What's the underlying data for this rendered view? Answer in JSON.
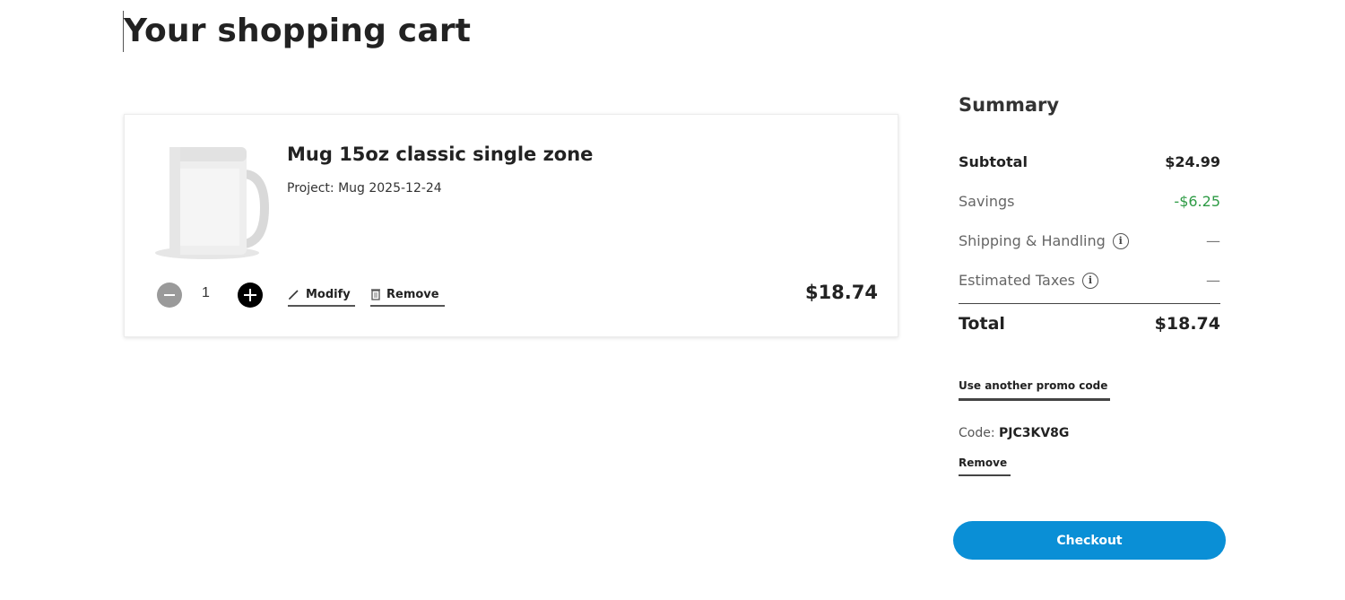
{
  "page": {
    "title": "Your shopping cart"
  },
  "cart": {
    "items": [
      {
        "name": "Mug 15oz classic single zone",
        "project_label": "Project: Mug 2025-12-24",
        "quantity": "1",
        "modify_label": "Modify",
        "remove_label": "Remove",
        "price": "$18.74",
        "image_icon": "mug-product-image"
      }
    ]
  },
  "summary": {
    "title": "Summary",
    "subtotal_label": "Subtotal",
    "subtotal_value": "$24.99",
    "savings_label": "Savings",
    "savings_value": "-$6.25",
    "shipping_label": "Shipping & Handling",
    "shipping_value": "—",
    "taxes_label": "Estimated Taxes",
    "taxes_value": "—",
    "total_label": "Total",
    "total_value": "$18.74",
    "promo_link": "Use another promo code",
    "code_prefix": "Code:",
    "code_value": "PJC3KV8G",
    "code_remove": "Remove",
    "checkout_label": "Checkout"
  },
  "colors": {
    "checkout": "#0a8fd6",
    "savings": "#2e9b45"
  }
}
